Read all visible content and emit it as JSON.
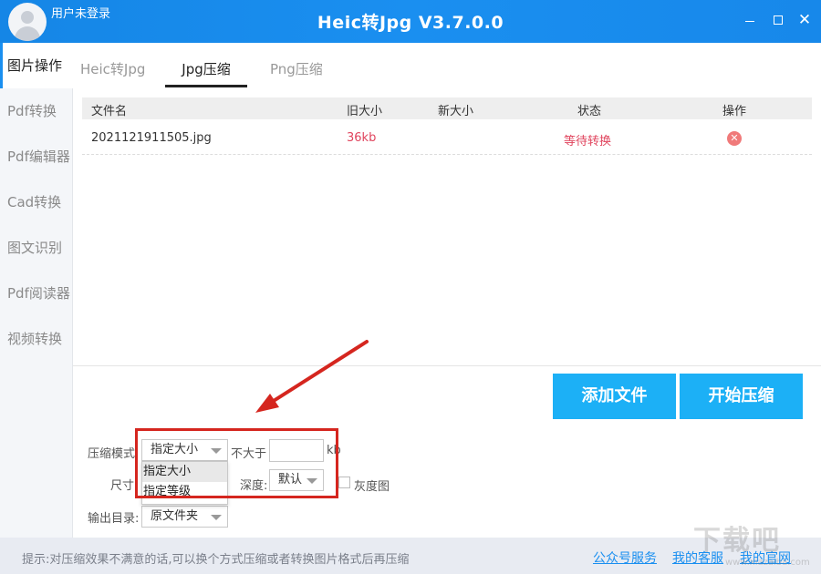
{
  "titlebar": {
    "user_label": "用户未登录",
    "app_title": "Heic转Jpg V3.7.0.0",
    "close_glyph": "✕"
  },
  "sidebar": {
    "items": [
      {
        "label": "图片操作"
      },
      {
        "label": "Pdf转换"
      },
      {
        "label": "Pdf编辑器"
      },
      {
        "label": "Cad转换"
      },
      {
        "label": "图文识别"
      },
      {
        "label": "Pdf阅读器"
      },
      {
        "label": "视频转换"
      }
    ],
    "active_index": 0
  },
  "tabs": [
    {
      "label": "Heic转Jpg"
    },
    {
      "label": "Jpg压缩"
    },
    {
      "label": "Png压缩"
    }
  ],
  "active_tab": 1,
  "table": {
    "columns": [
      "文件名",
      "旧大小",
      "新大小",
      "状态",
      "操作"
    ],
    "rows": [
      {
        "filename": "2021121911505.jpg",
        "old_size": "36kb",
        "new_size": "",
        "status": "等待转换",
        "action_icon": "delete-icon"
      }
    ]
  },
  "buttons": {
    "add_file": "添加文件",
    "start_compress": "开始压缩"
  },
  "settings": {
    "mode_label": "压缩模式",
    "mode_value": "指定大小",
    "mode_options": [
      "指定大小",
      "指定等级"
    ],
    "max_label": "不大于",
    "max_value": "",
    "max_unit": "kb",
    "size_label": "尺寸",
    "depth_label": "深度:",
    "depth_value": "默认",
    "gray_label": "灰度图",
    "output_label": "输出目录:",
    "output_value": "原文件夹"
  },
  "footer": {
    "tip": "提示:对压缩效果不满意的话,可以换个方式压缩或者转换图片格式后再压缩",
    "links": [
      "公众号服务",
      "我的客服",
      "我的官网"
    ]
  },
  "watermark": {
    "text": "下载吧",
    "sub": "www.xiazaiba.com"
  },
  "colors": {
    "accent": "#1a8ff0",
    "button": "#1cb0f6",
    "status_red": "#e0445d",
    "highlight": "#d5261f"
  }
}
